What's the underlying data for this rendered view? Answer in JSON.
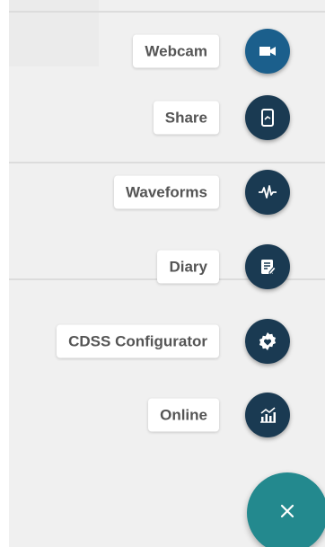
{
  "speed_dial": {
    "items": [
      {
        "label": "Webcam",
        "icon": "videocam-icon",
        "highlighted": true
      },
      {
        "label": "Share",
        "icon": "screen-share-icon",
        "highlighted": false
      },
      {
        "label": "Waveforms",
        "icon": "waveform-icon",
        "highlighted": false
      },
      {
        "label": "Diary",
        "icon": "diary-icon",
        "highlighted": false
      },
      {
        "label": "CDSS Configurator",
        "icon": "settings-heart-icon",
        "highlighted": false
      },
      {
        "label": "Online",
        "icon": "analytics-chart-icon",
        "highlighted": false
      }
    ],
    "close_icon": "close-icon"
  },
  "colors": {
    "background": "#f0f0f0",
    "fab_dark": "#1a3a52",
    "fab_highlight": "#1b5f8c",
    "close_fab": "#23898e",
    "label_text": "#555555",
    "label_bg": "#ffffff"
  }
}
